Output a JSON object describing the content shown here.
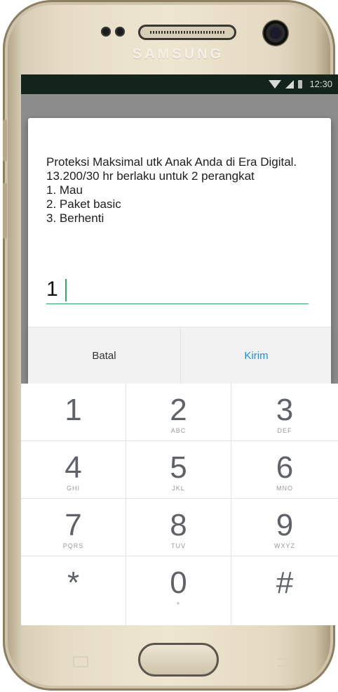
{
  "device": {
    "brand": "SAMSUNG"
  },
  "statusbar": {
    "time": "12:30"
  },
  "dialog": {
    "message": "Proteksi Maksimal utk Anak Anda di Era Digital. 13.200/30 hr berlaku untuk 2 perangkat\n1. Mau\n2. Paket basic\n3. Berhenti",
    "input_value": "1",
    "cancel_label": "Batal",
    "send_label": "Kirim"
  },
  "dialpad": {
    "keys": [
      {
        "digit": "1",
        "letters": ""
      },
      {
        "digit": "2",
        "letters": "ABC"
      },
      {
        "digit": "3",
        "letters": "DEF"
      },
      {
        "digit": "4",
        "letters": "GHI"
      },
      {
        "digit": "5",
        "letters": "JKL"
      },
      {
        "digit": "6",
        "letters": "MNO"
      },
      {
        "digit": "7",
        "letters": "PQRS"
      },
      {
        "digit": "8",
        "letters": "TUV"
      },
      {
        "digit": "9",
        "letters": "WXYZ"
      },
      {
        "digit": "*",
        "letters": ""
      },
      {
        "digit": "0",
        "letters": "+"
      },
      {
        "digit": "#",
        "letters": ""
      }
    ]
  },
  "colors": {
    "accent": "#2fa86b",
    "send": "#1b8fd8",
    "statusbar": "#15241b"
  }
}
